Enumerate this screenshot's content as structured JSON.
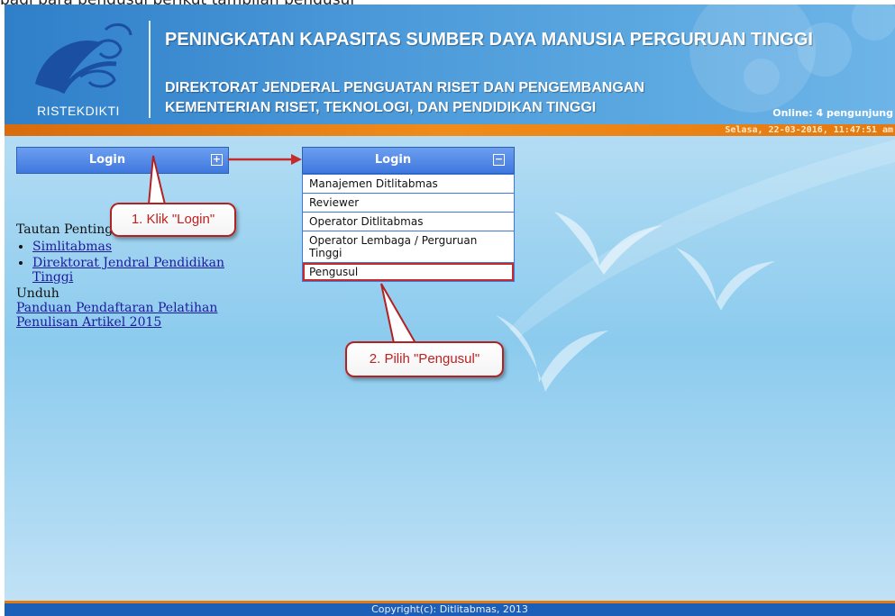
{
  "top_caption": "bagi para pengusul berikut tampilan pengusul",
  "header": {
    "logo_text": "RISTEKDIKTI",
    "title": "PENINGKATAN KAPASITAS SUMBER DAYA MANUSIA PERGURUAN TINGGI",
    "subtitle_line1": "DIREKTORAT JENDERAL PENGUATAN RISET DAN PENGEMBANGAN",
    "subtitle_line2": "KEMENTERIAN RISET, TEKNOLOGI, DAN PENDIDIKAN TINGGI",
    "online": "Online: 4 pengunjung",
    "datetime": "Selasa, 22-03-2016,  11:47:51 am"
  },
  "login_panel": {
    "label": "Login",
    "expand_symbol": "+"
  },
  "login_menu": {
    "label": "Login",
    "collapse_symbol": "−",
    "items": [
      "Manajemen Ditlitabmas",
      "Reviewer",
      "Operator Ditlitabmas",
      "Operator Lembaga / Perguruan Tinggi",
      "Pengusul"
    ]
  },
  "sidebar": {
    "links_heading": "Tautan Penting",
    "links": [
      "Simlitabmas",
      "Direktorat Jendral Pendidikan Tinggi"
    ],
    "download_heading": "Unduh",
    "download_link": "Panduan Pendaftaran Pelatihan Penulisan Artikel 2015"
  },
  "callouts": {
    "step1": "1. Klik \"Login\"",
    "step2": "2. Pilih \"Pengusul\""
  },
  "footer": {
    "copyright": "Copyright(c): Ditlitabmas, 2013"
  },
  "colors": {
    "header_blue": "#3f8bd2",
    "orange_bar": "#f08c1a",
    "login_blue": "#3f78df",
    "callout_red": "#c02020",
    "footer_blue": "#1b5fb9"
  }
}
